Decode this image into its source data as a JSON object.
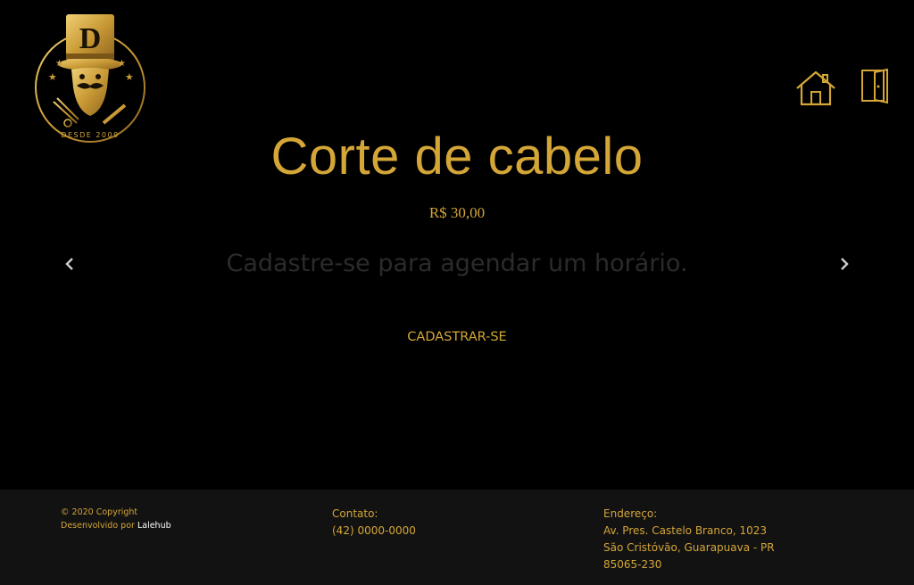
{
  "logo": {
    "since_text": "DESDE 2009",
    "monogram": "D"
  },
  "nav": {
    "home_icon": "home-icon",
    "exit_icon": "door-exit-icon"
  },
  "service": {
    "title": "Corte de cabelo",
    "price": "R$ 30,00"
  },
  "carousel": {
    "prompt": "Cadastre-se para agendar um horário.",
    "prev_icon": "chevron-left-icon",
    "next_icon": "chevron-right-icon"
  },
  "register": {
    "label": "CADASTRAR-SE"
  },
  "footer": {
    "copyright": "© 2020 Copyright",
    "developed_by": "Desenvolvido por",
    "developer": "Lalehub",
    "contact_label": "Contato:",
    "contact_phone": "(42) 0000-0000",
    "address_label": "Endereço:",
    "address_line1": "Av. Pres. Castelo Branco, 1023",
    "address_line2": "São Cristóvão, Guarapuava - PR",
    "address_line3": "85065-230"
  },
  "colors": {
    "gold": "#d4a637",
    "background": "#000000",
    "footer_bg": "#121212",
    "prompt": "#2b2b2b"
  }
}
